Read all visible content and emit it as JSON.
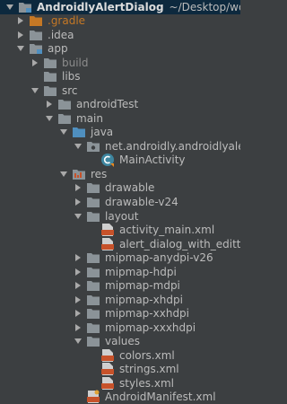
{
  "colors": {
    "background": "#3c3f41",
    "selection": "#0d293e",
    "folder": "#8b9398",
    "source_folder": "#4f8fbf",
    "excluded": "#c57825",
    "xml": "#c7522a"
  },
  "project": {
    "name": "AndroidlyAlertDialog",
    "path": "~/Desktop/workspace/An"
  },
  "tree": {
    "gradle": ".gradle",
    "idea": ".idea",
    "app": "app",
    "build": "build",
    "libs": "libs",
    "src": "src",
    "androidTest": "androidTest",
    "main": "main",
    "java": "java",
    "package": "net.androidly.androidlyalertdia",
    "main_activity": "MainActivity",
    "res": "res",
    "drawable": "drawable",
    "drawable_v24": "drawable-v24",
    "layout": "layout",
    "activity_main": "activity_main.xml",
    "alert_dialog": "alert_dialog_with_edittext.xm",
    "mipmap_anydpi": "mipmap-anydpi-v26",
    "mipmap_hdpi": "mipmap-hdpi",
    "mipmap_mdpi": "mipmap-mdpi",
    "mipmap_xhdpi": "mipmap-xhdpi",
    "mipmap_xxhdpi": "mipmap-xxhdpi",
    "mipmap_xxxhdpi": "mipmap-xxxhdpi",
    "values": "values",
    "colors": "colors.xml",
    "strings": "strings.xml",
    "styles": "styles.xml",
    "manifest": "AndroidManifest.xml"
  }
}
